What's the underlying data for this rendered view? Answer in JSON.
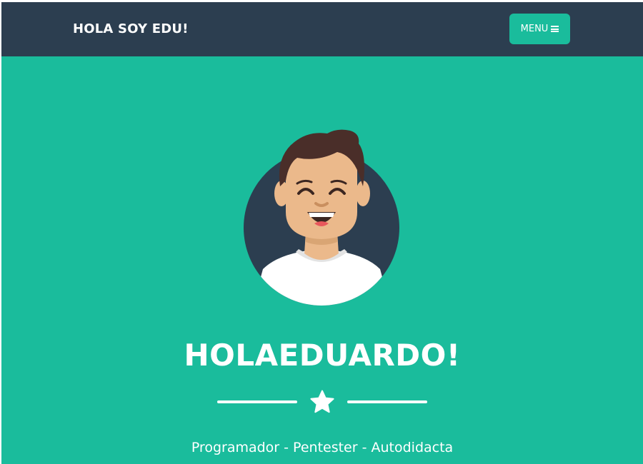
{
  "navbar": {
    "brand": "HOLA SOY EDU!",
    "menu_label": "MENU",
    "menu_icon": "hamburger-icon"
  },
  "hero": {
    "avatar_icon": "avatar-illustration",
    "title": "HOLAEDUARDO!",
    "divider_icon": "star-icon",
    "subtitle": "Programador - Pentester - Autodidacta"
  },
  "colors": {
    "navbar_bg": "#2c3e50",
    "accent": "#1abc9c",
    "text": "#ffffff",
    "avatar_circle": "#2c3e50",
    "skin": "#ebb98b",
    "hair": "#4a2e29",
    "shirt": "#ffffff"
  }
}
